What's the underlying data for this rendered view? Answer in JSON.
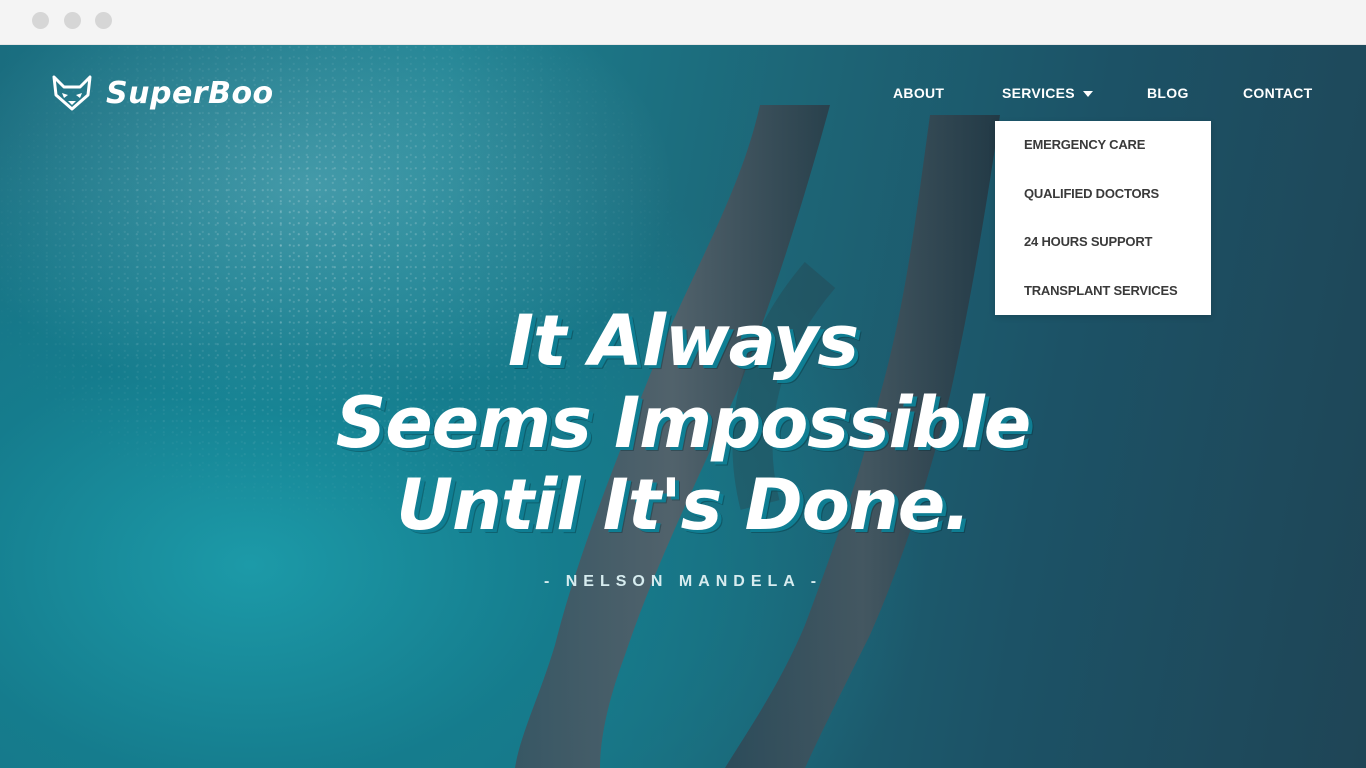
{
  "brand": {
    "name": "SuperBoo",
    "icon": "fox-head-icon"
  },
  "nav": {
    "about": "ABOUT",
    "services": "SERVICES",
    "blog": "BLOG",
    "contact": "CONTACT"
  },
  "services_menu": {
    "items": [
      "EMERGENCY CARE",
      "QUALIFIED DOCTORS",
      "24 HOURS SUPPORT",
      "TRANSPLANT SERVICES"
    ]
  },
  "hero": {
    "quote_lines": [
      "It Always",
      "Seems Impossible",
      "Until It's Done."
    ],
    "author": "- NELSON MANDELA -"
  },
  "colors": {
    "hero_teal": "#1b7f8f",
    "hero_dark": "#1f4556",
    "quote_shadow": "#0f7e93",
    "dropdown_bg": "#ffffff",
    "dropdown_text": "#3a3a3a"
  }
}
